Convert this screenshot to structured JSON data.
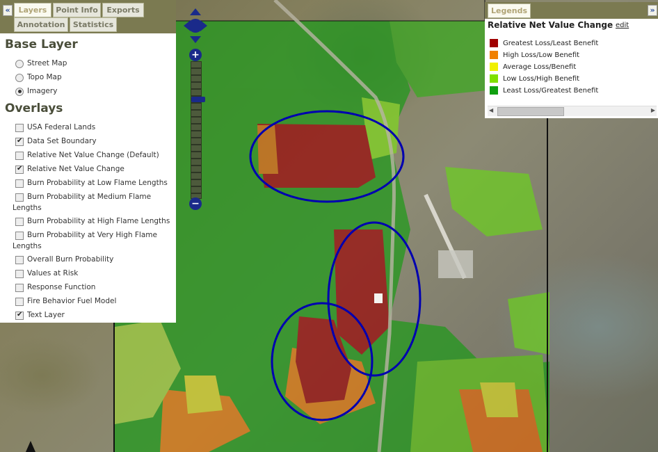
{
  "layers_panel": {
    "collapse_label": "«",
    "tabs": [
      {
        "label": "Layers",
        "active": true
      },
      {
        "label": "Point Info",
        "active": false
      },
      {
        "label": "Exports",
        "active": false
      },
      {
        "label": "Annotation",
        "active": false
      },
      {
        "label": "Statistics",
        "active": false
      }
    ],
    "base_layer": {
      "title": "Base Layer",
      "options": [
        {
          "label": "Street Map",
          "selected": false
        },
        {
          "label": "Topo Map",
          "selected": false
        },
        {
          "label": "Imagery",
          "selected": true
        }
      ]
    },
    "overlays": {
      "title": "Overlays",
      "items": [
        {
          "label": "USA Federal Lands",
          "checked": false
        },
        {
          "label": "Data Set Boundary",
          "checked": true
        },
        {
          "label": "Relative Net Value Change (Default)",
          "checked": false
        },
        {
          "label": "Relative Net Value Change",
          "checked": true
        },
        {
          "label": "Burn Probability at Low Flame Lengths",
          "checked": false
        },
        {
          "label": "Burn Probability at Medium Flame Lengths",
          "checked": false
        },
        {
          "label": "Burn Probability at High Flame Lengths",
          "checked": false
        },
        {
          "label": "Burn Probability at Very High Flame Lengths",
          "checked": false
        },
        {
          "label": "Overall Burn Probability",
          "checked": false
        },
        {
          "label": "Values at Risk",
          "checked": false
        },
        {
          "label": "Response Function",
          "checked": false
        },
        {
          "label": "Fire Behavior Fuel Model",
          "checked": false
        },
        {
          "label": "Text Layer",
          "checked": true
        }
      ]
    }
  },
  "legends_panel": {
    "tab_label": "Legends",
    "expand_label": "»",
    "title": "Relative Net Value Change",
    "edit_label": "edit",
    "entries": [
      {
        "label": "Greatest Loss/Least Benefit",
        "color": "#a00000"
      },
      {
        "label": "High Loss/Low Benefit",
        "color": "#f08000"
      },
      {
        "label": "Average Loss/Benefit",
        "color": "#f0f000"
      },
      {
        "label": "Low Loss/High Benefit",
        "color": "#80e000"
      },
      {
        "label": "Least Loss/Greatest Benefit",
        "color": "#10a010"
      }
    ],
    "scroll_left": "◀",
    "scroll_right": "▶"
  },
  "map": {
    "zoom_in_label": "+",
    "zoom_out_label": "−",
    "annotation_color": "#0000b0",
    "data_boundary_color": "#111111"
  }
}
